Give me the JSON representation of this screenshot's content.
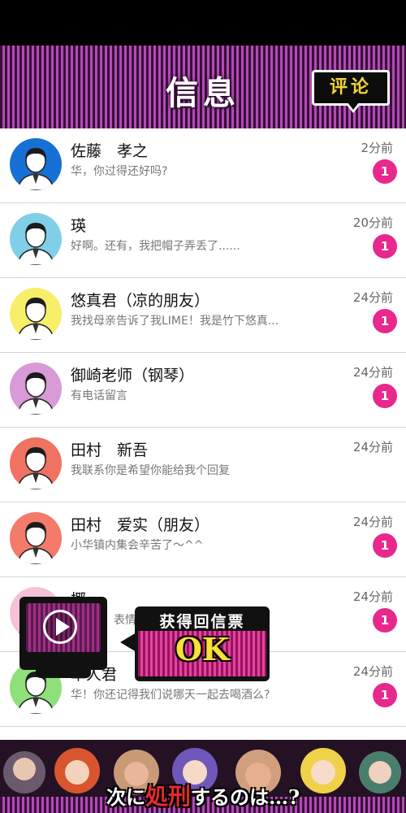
{
  "header": {
    "title": "信息",
    "review_label": "评论"
  },
  "messages": [
    {
      "name": "佐藤　孝之",
      "preview": "华，你过得还好吗?",
      "time": "2分前",
      "unread": "1",
      "avatar_bg": "#1670d6"
    },
    {
      "name": "瑛",
      "preview": "好啊。还有，我把帽子弄丢了......",
      "time": "20分前",
      "unread": "1",
      "avatar_bg": "#7fcfe8"
    },
    {
      "name": "悠真君（凉的朋友）",
      "preview": "我找母亲告诉了我LIME！我是竹下悠真...",
      "time": "24分前",
      "unread": "1",
      "avatar_bg": "#f7ef6a"
    },
    {
      "name": "御崎老师（钢琴）",
      "preview": "有电话留言",
      "time": "24分前",
      "unread": "1",
      "avatar_bg": "#d99ad8"
    },
    {
      "name": "田村　新吾",
      "preview": "我联系你是希望你能给我个回复",
      "time": "24分前",
      "unread": "",
      "avatar_bg": "#f07262"
    },
    {
      "name": "田村　爱实（朋友）",
      "preview": "小华镇内集会辛苦了～^^",
      "time": "24分前",
      "unread": "1",
      "avatar_bg": "#f47a6a"
    },
    {
      "name": "椰",
      "preview": "表情",
      "time": "24分前",
      "unread": "1",
      "avatar_bg": "#f5c1d6"
    },
    {
      "name": "隼人君",
      "preview": "华！你还记得我们说哪天一起去喝酒么?",
      "time": "24分前",
      "unread": "1",
      "avatar_bg": "#8fe07a"
    }
  ],
  "reward_popup": {
    "title": "获得回信票",
    "ok_label": "OK"
  },
  "banner": {
    "text_pre": "次に",
    "text_red": "処刑",
    "text_post": "するのは…?"
  },
  "colors": {
    "accent_pink": "#e8288c",
    "header_purple": "#b04cb4",
    "ok_yellow": "#f7e13a",
    "review_yellow": "#f3d437"
  }
}
